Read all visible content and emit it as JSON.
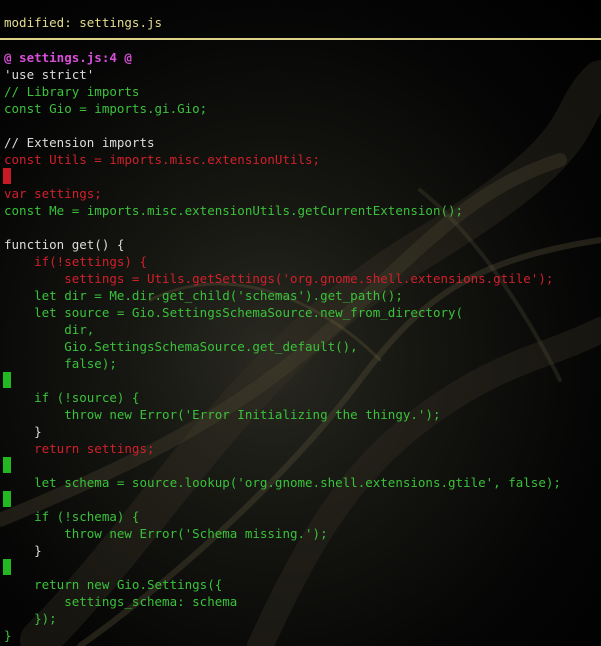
{
  "header": {
    "title": "modified: settings.js"
  },
  "colors": {
    "added": "#3ac23a",
    "removed": "#d0202a",
    "hunk": "#d84ed8",
    "context": "#dcdcdc",
    "header_rule": "#ddd48a"
  },
  "diff": {
    "lines": [
      {
        "type": "hunk",
        "text": "@ settings.js:4 @"
      },
      {
        "type": "ctx",
        "text": "'use strict'"
      },
      {
        "type": "add",
        "text": "// Library imports"
      },
      {
        "type": "add",
        "text": "const Gio = imports.gi.Gio;"
      },
      {
        "type": "ctx",
        "text": ""
      },
      {
        "type": "ctx",
        "text": "// Extension imports"
      },
      {
        "type": "del",
        "text": "const Utils = imports.misc.extensionUtils;"
      },
      {
        "type": "del",
        "text": "",
        "marker": true
      },
      {
        "type": "del",
        "text": "var settings;"
      },
      {
        "type": "add",
        "text": "const Me = imports.misc.extensionUtils.getCurrentExtension();"
      },
      {
        "type": "ctx",
        "text": ""
      },
      {
        "type": "ctx",
        "text": "function get() {"
      },
      {
        "type": "del",
        "text": "    if(!settings) {"
      },
      {
        "type": "del",
        "text": "        settings = Utils.getSettings('org.gnome.shell.extensions.gtile');"
      },
      {
        "type": "add",
        "text": "    let dir = Me.dir.get_child('schemas').get_path();"
      },
      {
        "type": "add",
        "text": "    let source = Gio.SettingsSchemaSource.new_from_directory("
      },
      {
        "type": "add",
        "text": "        dir,"
      },
      {
        "type": "add",
        "text": "        Gio.SettingsSchemaSource.get_default(),"
      },
      {
        "type": "add",
        "text": "        false);"
      },
      {
        "type": "add",
        "text": "",
        "marker": true
      },
      {
        "type": "add",
        "text": "    if (!source) {"
      },
      {
        "type": "add",
        "text": "        throw new Error('Error Initializing the thingy.');"
      },
      {
        "type": "ctx",
        "text": "    }"
      },
      {
        "type": "del",
        "text": "    return settings;"
      },
      {
        "type": "add",
        "text": "",
        "marker": true
      },
      {
        "type": "add",
        "text": "    let schema = source.lookup('org.gnome.shell.extensions.gtile', false);"
      },
      {
        "type": "add",
        "text": "",
        "marker": true
      },
      {
        "type": "add",
        "text": "    if (!schema) {"
      },
      {
        "type": "add",
        "text": "        throw new Error('Schema missing.');"
      },
      {
        "type": "ctx",
        "text": "    }"
      },
      {
        "type": "add",
        "text": "",
        "marker": true
      },
      {
        "type": "add",
        "text": "    return new Gio.Settings({"
      },
      {
        "type": "add",
        "text": "        settings_schema: schema"
      },
      {
        "type": "add",
        "text": "    });"
      },
      {
        "type": "add",
        "text": "}"
      }
    ]
  }
}
